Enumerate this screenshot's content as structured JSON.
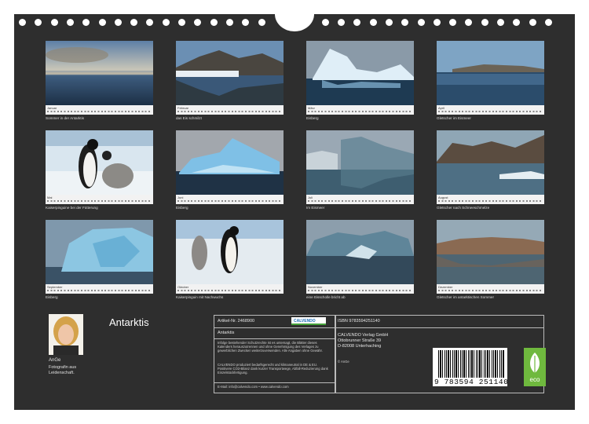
{
  "calendar": {
    "title": "Antarktis",
    "months": [
      {
        "name": "Januar",
        "caption": "Sommer in der Antarktis"
      },
      {
        "name": "Februar",
        "caption": "das Eis schmilzt"
      },
      {
        "name": "März",
        "caption": "Eisberg"
      },
      {
        "name": "April",
        "caption": "Gletscher im Eismeer"
      },
      {
        "name": "Mai",
        "caption": "Kaiserpinguine bei der Fütterung"
      },
      {
        "name": "Juni",
        "caption": "Eisberg"
      },
      {
        "name": "Juli",
        "caption": "Im Eismeer"
      },
      {
        "name": "August",
        "caption": "Gletscher nach Schneeschmelze"
      },
      {
        "name": "September",
        "caption": "Eisberg"
      },
      {
        "name": "Oktober",
        "caption": "Kaiserpinguin mit Nachwuchs"
      },
      {
        "name": "November",
        "caption": "eine Eisscholle bricht ab"
      },
      {
        "name": "Dezember",
        "caption": "Gletscher im antarktischen Sommer"
      }
    ]
  },
  "author": {
    "name": "AnGe",
    "description": "Fotografin aus Leidenschaft."
  },
  "info": {
    "article": "Artikel-Nr. 2468900",
    "logo": "CALVENDO",
    "title": "Antarktis",
    "legal": "Infolge bestehender Schutzrechte ist es untersagt, die Blätter dieses Kalenders herauszutrennen und ohne Genehmigung des Verlages zu gewerblichen Zwecken weiterzuverwenden. Alle Angaben ohne Gewähr.",
    "climate": "CALVENDO produziert bedarfsgerecht und klimaneutral in DE & EU. Positivere CO2-Bilanz dank kurzer Transportwege, Abfall-Reduzierung dank Einzelstückfertigung.",
    "contact": "E-Mail: info@calvendo.com • www.calvendo.com"
  },
  "publisher": {
    "isbn": "ISBN 9783594251140",
    "lines": [
      "CALVENDO Verlag GmbH",
      "Ottobrunner Straße 39",
      "D-82008 Unterhaching"
    ],
    "copyright": "© AnGe",
    "barcode_digits": "9 783594 251140",
    "eco_label": "eco"
  },
  "colors": {
    "background": "#2e2e2e",
    "eco_green": "#6fb93e"
  }
}
